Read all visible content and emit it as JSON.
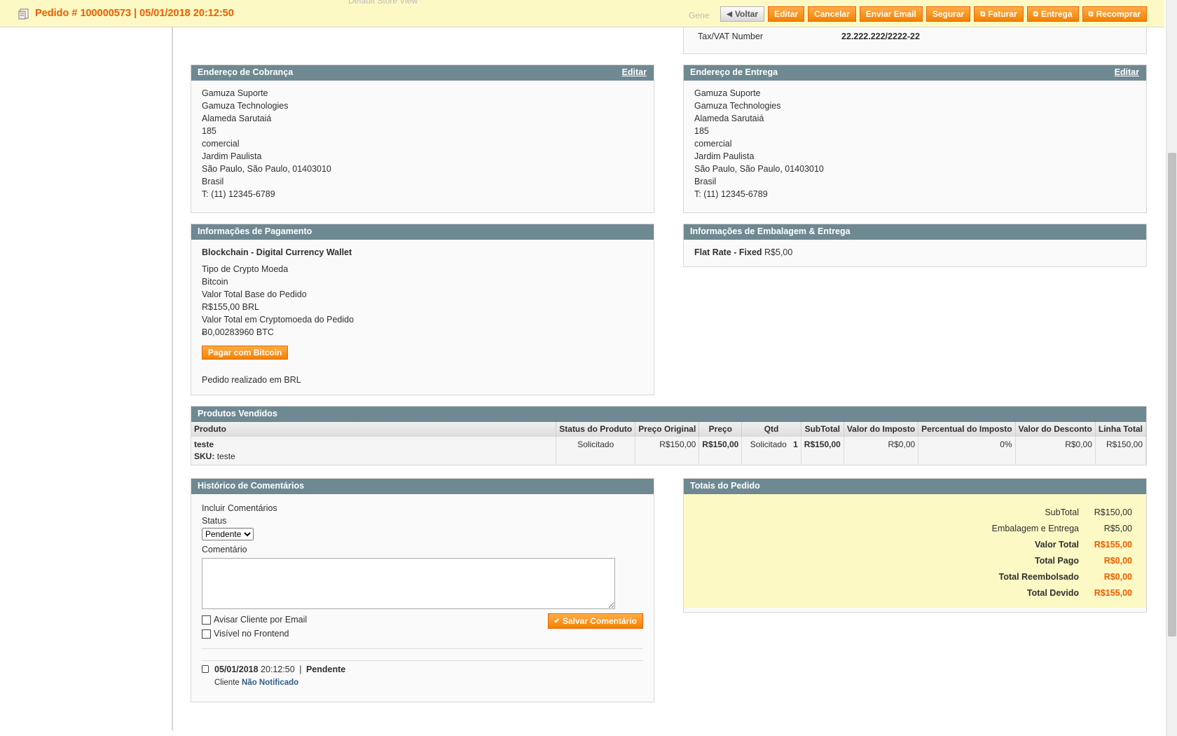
{
  "header": {
    "title": "Pedido # 100000573 | 05/01/2018 20:12:50",
    "hidden_fragment": "Gene",
    "hidden_fragment2": "Default Store View",
    "buttons": {
      "back": "Voltar",
      "edit": "Editar",
      "cancel": "Cancelar",
      "send_email": "Enviar Email",
      "hold": "Segurar",
      "invoice": "Faturar",
      "ship": "Entrega",
      "reorder": "Recomprar"
    }
  },
  "account": {
    "tax_label": "Tax/VAT Number",
    "tax_value": "22.222.222/2222-22"
  },
  "billing": {
    "title": "Endereço de Cobrança",
    "edit_label": "Editar",
    "lines": [
      "Gamuza Suporte",
      "Gamuza Technologies",
      "Alameda Sarutaiá",
      "185",
      "comercial",
      "Jardim Paulista",
      "São Paulo, São Paulo, 01403010",
      "Brasil",
      "T: (11) 12345-6789"
    ]
  },
  "shipping": {
    "title": "Endereço de Entrega",
    "edit_label": "Editar",
    "lines": [
      "Gamuza Suporte",
      "Gamuza Technologies",
      "Alameda Sarutaiá",
      "185",
      "comercial",
      "Jardim Paulista",
      "São Paulo, São Paulo, 01403010",
      "Brasil",
      "T: (11) 12345-6789"
    ]
  },
  "payment": {
    "title": "Informações de Pagamento",
    "method": "Blockchain - Digital Currency Wallet",
    "lines": [
      "Tipo de Crypto Moeda",
      "Bitcoin",
      "Valor Total Base do Pedido",
      "R$155,00 BRL",
      "Valor Total em Cryptomoeda do Pedido",
      "Ƀ0,00283960 BTC"
    ],
    "pay_button": "Pagar com Bitcoin",
    "currency_note": "Pedido realizado em BRL"
  },
  "shipping_method": {
    "title": "Informações de Embalagem & Entrega",
    "method": "Flat Rate - Fixed",
    "price": "R$5,00"
  },
  "products": {
    "title": "Produtos Vendidos",
    "columns": [
      "Produto",
      "Status do Produto",
      "Preço Original",
      "Preço",
      "Qtd",
      "SubTotal",
      "Valor do Imposto",
      "Percentual do Imposto",
      "Valor do Desconto",
      "Linha Total"
    ],
    "row": {
      "name": "teste",
      "sku_label": "SKU:",
      "sku": "teste",
      "status": "Solicitado",
      "original_price": "R$150,00",
      "price": "R$150,00",
      "qty_label": "Solicitado",
      "qty": "1",
      "subtotal": "R$150,00",
      "tax_amount": "R$0,00",
      "tax_percent": "0%",
      "discount": "R$0,00",
      "row_total": "R$150,00"
    }
  },
  "comments": {
    "title": "Histórico de Comentários",
    "include_label": "Incluir Comentários",
    "status_label": "Status",
    "status_value": "Pendente",
    "comment_label": "Comentário",
    "notify_label": "Avisar Cliente por Email",
    "visible_label": "Visível no Frontend",
    "save_button": "Salvar Comentário",
    "history": {
      "date": "05/01/2018",
      "time": "20:12:50",
      "separator": "|",
      "status": "Pendente",
      "customer_label": "Cliente",
      "notified": "Não Notificado"
    }
  },
  "totals": {
    "title": "Totais do Pedido",
    "rows": [
      {
        "label": "SubTotal",
        "value": "R$150,00"
      },
      {
        "label": "Embalagem e Entrega",
        "value": "R$5,00"
      },
      {
        "label": "Valor Total",
        "value": "R$155,00"
      },
      {
        "label": "Total Pago",
        "value": "R$0,00"
      },
      {
        "label": "Total Reembolsado",
        "value": "R$0,00"
      },
      {
        "label": "Total Devido",
        "value": "R$155,00"
      }
    ]
  },
  "colors": {
    "accent": "#eb5e00",
    "header_bg": "#fdf9c4",
    "box_head": "#6f8992",
    "button": "#f18200"
  }
}
